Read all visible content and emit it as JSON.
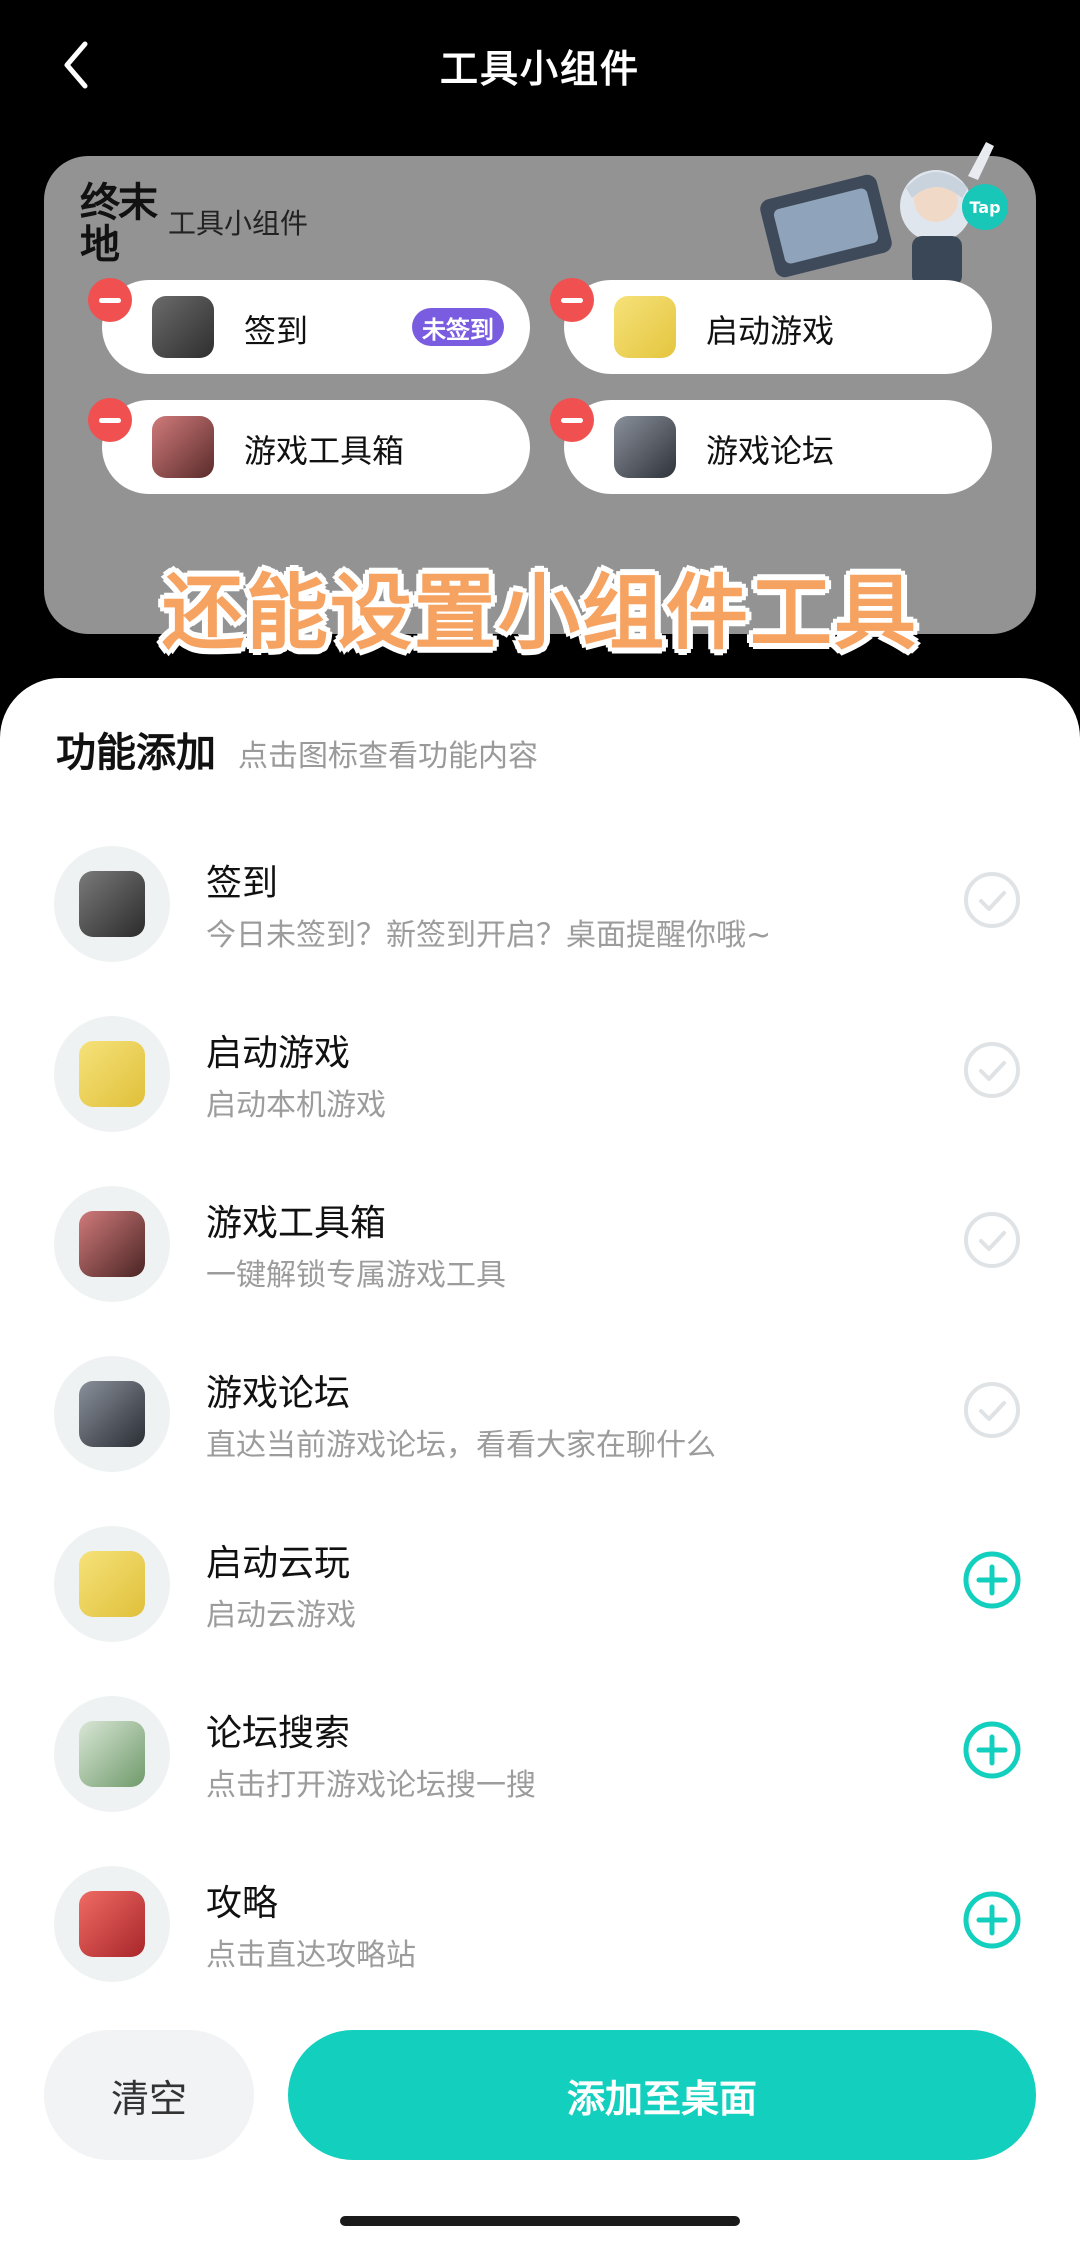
{
  "header": {
    "title": "工具小组件"
  },
  "preview": {
    "logo_line1": "终末",
    "logo_line2": "地",
    "widget_title": "工具小组件",
    "tap_badge": "Tap",
    "caption": "还能设置小组件工具",
    "pills": [
      {
        "label": "签到",
        "badge": "未签到",
        "color": "#4a4a4a"
      },
      {
        "label": "启动游戏",
        "color": "#f2d84f"
      },
      {
        "label": "游戏工具箱",
        "color": "#b25656"
      },
      {
        "label": "游戏论坛",
        "color": "#5a5f6a"
      }
    ]
  },
  "section": {
    "title": "功能添加",
    "hint": "点击图标查看功能内容"
  },
  "features": [
    {
      "name": "签到",
      "desc": "今日未签到？新签到开启？桌面提醒你哦~",
      "state": "added",
      "color": "#4a4a4a"
    },
    {
      "name": "启动游戏",
      "desc": "启动本机游戏",
      "state": "added",
      "color": "#f2d84f"
    },
    {
      "name": "游戏工具箱",
      "desc": "一键解锁专属游戏工具",
      "state": "added",
      "color": "#b25656"
    },
    {
      "name": "游戏论坛",
      "desc": "直达当前游戏论坛，看看大家在聊什么",
      "state": "added",
      "color": "#5a5f6a"
    },
    {
      "name": "启动云玩",
      "desc": "启动云游戏",
      "state": "add",
      "color": "#f2d84f"
    },
    {
      "name": "论坛搜索",
      "desc": "点击打开游戏论坛搜一搜",
      "state": "add",
      "color": "#7fae7c"
    },
    {
      "name": "攻略",
      "desc": "点击直达攻略站",
      "state": "add",
      "color": "#d8443f"
    }
  ],
  "buttons": {
    "clear": "清空",
    "add": "添加至桌面"
  },
  "colors": {
    "accent": "#13cfbd",
    "remove": "#f0504f",
    "badge": "#7a5ce0"
  }
}
